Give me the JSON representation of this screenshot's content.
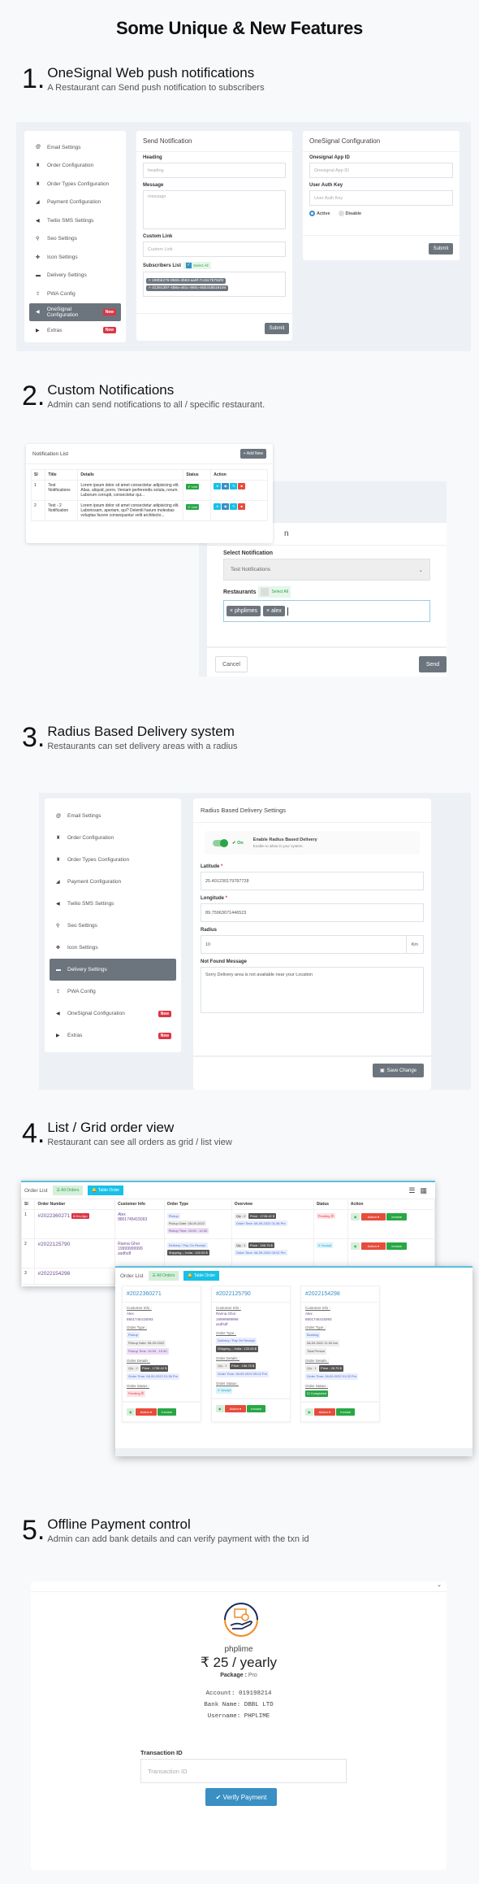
{
  "title": "Some Unique & New Features",
  "sections": [
    {
      "num": "1.",
      "title": "OneSignal Web push notifications",
      "sub": "A Restaurant can Send push notification to  subscribers"
    },
    {
      "num": "2.",
      "title": "Custom Notifications",
      "sub": "Admin can send notifications to all / specific restaurant."
    },
    {
      "num": "3.",
      "title": "Radius Based Delivery system",
      "sub": "Restaurants can set delivery areas with a radius"
    },
    {
      "num": "4.",
      "title": "List / Grid order view",
      "sub": "Restaurant can see all orders as grid / list view"
    },
    {
      "num": "5.",
      "title": "Offline Payment control",
      "sub": "Admin can add bank details and can verify payment with the txn id"
    }
  ],
  "sidebar": [
    {
      "label": "Email Settings",
      "icon": "@"
    },
    {
      "label": "Order Configuration",
      "icon": "♜"
    },
    {
      "label": "Order Types Configuration",
      "icon": "♜"
    },
    {
      "label": "Payment Configuration",
      "icon": "◢"
    },
    {
      "label": "Twilio SMS Settings",
      "icon": "◀"
    },
    {
      "label": "Seo Settings",
      "icon": "⚲"
    },
    {
      "label": "Icon Settings",
      "icon": "✤"
    },
    {
      "label": "Delivery Settings",
      "icon": "▬"
    },
    {
      "label": "PWA Config",
      "icon": "⇪"
    },
    {
      "label": "OneSignal Configuration",
      "icon": "◀",
      "badge": "New"
    },
    {
      "label": "Extras",
      "icon": "▶",
      "badge": "New"
    }
  ],
  "send_notification": {
    "title": "Send Notification",
    "heading_label": "Heading",
    "heading_placeholder": "heading",
    "message_label": "Message",
    "message_placeholder": "message",
    "link_label": "Custom Link",
    "link_placeholder": "Custom Link",
    "subs_label": "Subscribers List",
    "select_all": "Select All",
    "subscribers": [
      "× 190bb276-9565-4b63-aa8f-7cc6c7b762f2",
      "× d1291397-488a-481c-860c-65b318b19194"
    ],
    "submit": "Submit"
  },
  "onesignal_config": {
    "title": "OneSignal Configuration",
    "app_id_label": "Onesignal App ID",
    "app_id_placeholder": "Onesignal App ID",
    "auth_label": "User Auth Key",
    "auth_placeholder": "User Auth Key",
    "active": "Active",
    "disable": "Disable",
    "submit": "Submit"
  },
  "notification_list": {
    "title": "Notification List",
    "add_new": "+ Add New",
    "columns": [
      "Sl",
      "Title",
      "Details",
      "Status",
      "Action"
    ],
    "rows": [
      {
        "sl": "1",
        "title": "Test Notifications",
        "details": "Lorem ipsum dolor sit amet consectetur adipisicing elit. Alias, aliquid, porro. Veniam perferendis soluta, rerum. Laborum corrupti, consectetur qui...",
        "status": "✔ Live"
      },
      {
        "sl": "2",
        "title": "Test - 2 Notification",
        "details": "Lorem ipsum dolor sit amet consectetur adipisicing elit. Laboriosam, aperiam, qui? Deleniti harum molestias voluptas facere consequuntur velit architecto...",
        "status": "✔ Live"
      }
    ]
  },
  "send_modal": {
    "title_partial": "n",
    "select_label": "Select Notification",
    "select_value": "Test Notifications",
    "restaurants_label": "Restaurants",
    "select_all": "Select All",
    "chips": [
      "× phplimes",
      "× alex"
    ],
    "cancel": "Cancel",
    "send": "Send"
  },
  "radius": {
    "title": "Radius Based Delivery Settings",
    "toggle_state": "✔ On",
    "enable_title": "Enable Radius Based Delivery",
    "enable_sub": "Enable to allow in your system.",
    "lat_label": "Latitude",
    "lat_value": "25.401230179787728",
    "lng_label": "Longitude",
    "lng_value": "89.75963071446523",
    "radius_label": "Radius",
    "radius_value": "10",
    "radius_unit": "Km",
    "msg_label": "Not Found Message",
    "msg_value": "Sorry Delivery area is not available near  your Location",
    "save": "Save Change",
    "required": "*"
  },
  "order_list": {
    "title": "Order List",
    "all_orders": "All Orders",
    "table_order": "Table Order",
    "columns": [
      "Sl",
      "Order Number",
      "Customer Info",
      "Order Type",
      "Overview",
      "Status",
      "Action"
    ],
    "rows": [
      {
        "sl": "1",
        "number": "#2022360271",
        "age": "8 Hrs Ago",
        "customer": [
          "Alex",
          "8801745415093"
        ],
        "type": [
          "Pickup",
          "Pickup Date: 08-09-2022",
          "Pickup Time: 10:00 - 10:30"
        ],
        "qty": "Qty : 2",
        "price": "Price : 1728.42 $",
        "time": "Order Time: 08-09-2022 01:36 Pm",
        "status": "Pending ⏱"
      },
      {
        "sl": "2",
        "number": "#2022125790",
        "customer": [
          "Ranna Ghor",
          "19999999999",
          "asdfsdf"
        ],
        "type": [
          "Delivery / Pay On Receipt",
          "Shipping -- India : 120.00 $"
        ],
        "qty": "Qty : 1",
        "price": "Price : 156.75 $",
        "time": "Order Time: 08-09-2022 05:02 Pm",
        "status": "✔ Accept"
      },
      {
        "sl": "3",
        "number": "#2022154298"
      }
    ],
    "action": "Action",
    "invoice": "Invoice"
  },
  "grid": {
    "cards": [
      {
        "number": "#2022360271",
        "customer": [
          "Alex",
          "8801745415093"
        ],
        "type": [
          "Pickup",
          "Pickup Date: 08-09-2022",
          "Pickup Time: 10:00 - 10:30"
        ],
        "qty": "Qty : 2",
        "price": "Price : 1728.42 $",
        "time": "Order Time: 08-09-2022 01:36 Pm",
        "status": "Pending ⏱"
      },
      {
        "number": "#2022125790",
        "customer": [
          "Ranna Ghor",
          "19999999999",
          "asdfsdf"
        ],
        "type": [
          "Delivery / Pay On Receipt",
          "Shipping -- India : 120.00 $"
        ],
        "qty": "Qty : 1",
        "price": "Price : 156.75 $",
        "time": "Order Time: 08-09-2022 05:02 Pm",
        "status": "✔ Accept"
      },
      {
        "number": "#2022154298",
        "customer": [
          "Alex",
          "8801745415093"
        ],
        "type": [
          "Booking",
          "08-09-2022 11:00 Am",
          "Total Person"
        ],
        "qty": "Qty : 1",
        "price": "Price : 28.75 $",
        "time": "Order Time: 08-09-2022 01:33 Pm",
        "status": "☑ Completed"
      }
    ],
    "labels": {
      "customer": "Customer Info :",
      "type": "Order Type :",
      "details": "Order Details :",
      "status": "Order Status :"
    }
  },
  "payment": {
    "name": "phplime",
    "price": "₹ 25 / yearly",
    "package_label": "Package :",
    "package": "Pro",
    "account": "Account: 019198214",
    "bank": "Bank Name: DBBL LTD",
    "username": "Username: PHPLIME",
    "txn_label": "Transaction ID",
    "txn_placeholder": "Transaction ID",
    "verify": "✔ Verify Payment"
  },
  "colors": {
    "accent_grey": "#6c757d",
    "new_red": "#dc3545",
    "green": "#28a745",
    "info": "#17c1e8",
    "primary": "#3a8fc3",
    "orange": "#f08a24",
    "navy": "#1d2b5b"
  }
}
